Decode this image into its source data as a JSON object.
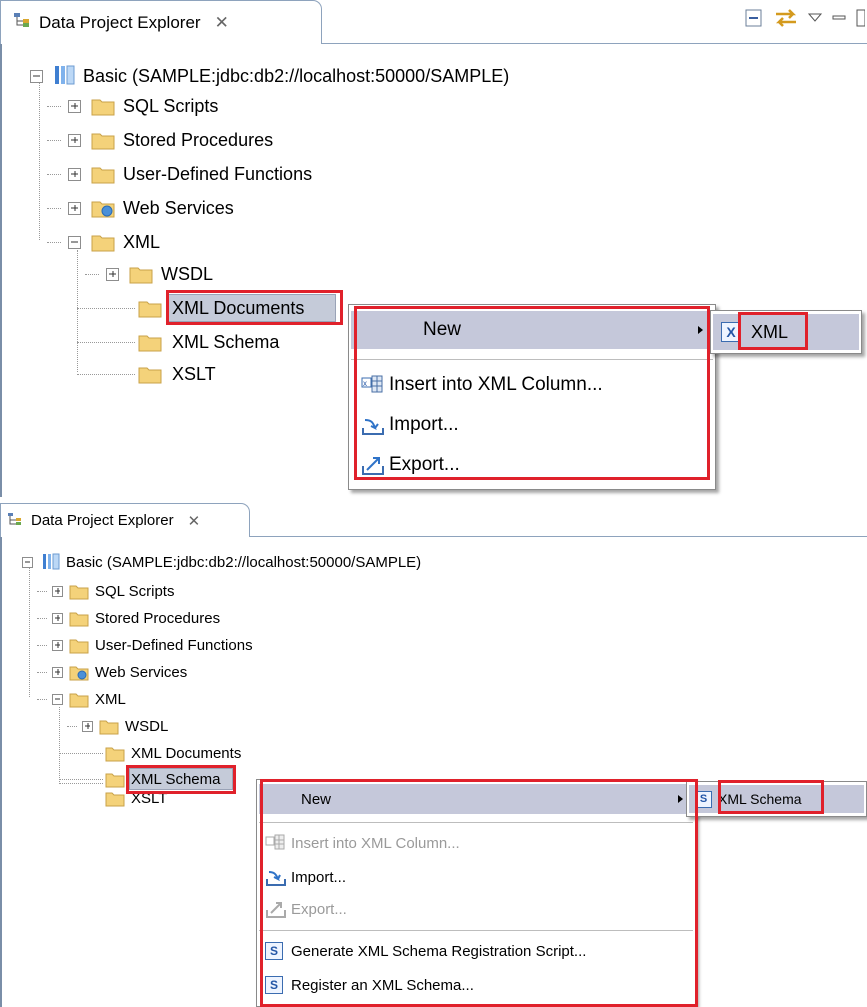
{
  "top": {
    "tab_title": "Data Project Explorer",
    "tab_close": "✕",
    "root": "Basic (SAMPLE:jdbc:db2://localhost:50000/SAMPLE)",
    "items": [
      "SQL Scripts",
      "Stored Procedures",
      "User-Defined Functions",
      "Web Services",
      "XML"
    ],
    "xml_children": [
      "WSDL",
      "XML Documents",
      "XML Schema",
      "XSLT"
    ],
    "menu": {
      "new": "New",
      "insert": "Insert into XML Column...",
      "import": "Import...",
      "export": "Export..."
    },
    "submenu": {
      "badge": "X",
      "label": "XML"
    }
  },
  "bottom": {
    "tab_title": "Data Project Explorer",
    "tab_close": "✕",
    "root": "Basic (SAMPLE:jdbc:db2://localhost:50000/SAMPLE)",
    "items": [
      "SQL Scripts",
      "Stored Procedures",
      "User-Defined Functions",
      "Web Services",
      "XML"
    ],
    "xml_children": [
      "WSDL",
      "XML Documents",
      "XML Schema",
      "XSLT"
    ],
    "menu": {
      "new": "New",
      "insert": "Insert into XML Column...",
      "import": "Import...",
      "export": "Export...",
      "generate": "Generate XML Schema Registration Script...",
      "register": "Register an XML Schema..."
    },
    "submenu": {
      "badge": "S",
      "label": "XML Schema"
    }
  },
  "icons": {
    "tree": "tree-view-icon",
    "database": "database-icon",
    "folder": "folder-icon",
    "web_folder": "web-services-folder-icon",
    "insert": "insert-xml-icon",
    "import": "import-icon",
    "export": "export-icon",
    "schema": "schema-file-icon",
    "xml_file": "xml-file-icon"
  },
  "colors": {
    "highlight": "#e0212b",
    "menu_hover": "#c5c8da",
    "folder": "#f4d27a"
  }
}
